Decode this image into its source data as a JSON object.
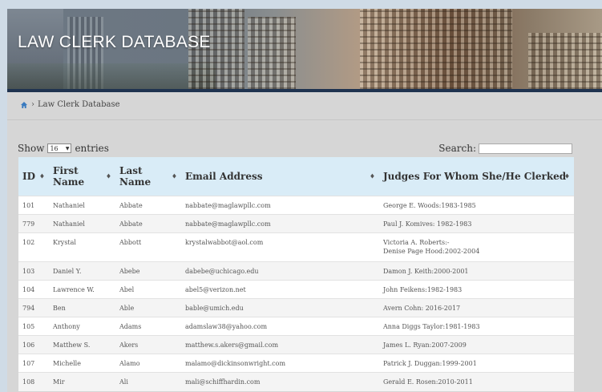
{
  "header": {
    "title": "LAW CLERK DATABASE"
  },
  "breadcrumb": {
    "icon": "home-icon",
    "separator": "›",
    "current": "Law Clerk Database"
  },
  "controls": {
    "show_label": "Show",
    "page_size": "16",
    "entries_label": "entries",
    "search_label": "Search:",
    "search_value": ""
  },
  "table": {
    "columns": [
      "ID",
      "First Name",
      "Last Name",
      "Email Address",
      "Judges For Whom She/He Clerked"
    ],
    "rows": [
      {
        "id": "101",
        "first": "Nathaniel",
        "last": "Abbate",
        "email": "nabbate@maglawpllc.com",
        "judges": "George E. Woods:1983-1985"
      },
      {
        "id": "779",
        "first": "Nathaniel",
        "last": "Abbate",
        "email": "nabbate@maglawpllc.com",
        "judges": "Paul J. Komives: 1982-1983"
      },
      {
        "id": "102",
        "first": "Krystal",
        "last": "Abbott",
        "email": "krystalwabbot@aol.com",
        "judges": "Victoria A. Roberts:-",
        "judges2": "Denise Page Hood:2002-2004"
      },
      {
        "id": "103",
        "first": "Daniel Y.",
        "last": "Abebe",
        "email": "dabebe@uchicago.edu",
        "judges": "Damon J. Keith:2000-2001"
      },
      {
        "id": "104",
        "first": "Lawrence W.",
        "last": "Abel",
        "email": "abel5@verizon.net",
        "judges": "John Feikens:1982-1983"
      },
      {
        "id": "794",
        "first": "Ben",
        "last": "Able",
        "email": "bable@umich.edu",
        "judges": "Avern Cohn: 2016-2017"
      },
      {
        "id": "105",
        "first": "Anthony",
        "last": "Adams",
        "email": "adamslaw38@yahoo.com",
        "judges": "Anna Diggs Taylor:1981-1983"
      },
      {
        "id": "106",
        "first": "Matthew S.",
        "last": "Akers",
        "email": "matthew.s.akers@gmail.com",
        "judges": "James L. Ryan:2007-2009"
      },
      {
        "id": "107",
        "first": "Michelle",
        "last": "Alamo",
        "email": "malamo@dickinsonwright.com",
        "judges": "Patrick J. Duggan:1999-2001"
      },
      {
        "id": "108",
        "first": "Mir",
        "last": "Ali",
        "email": "mali@schiffhardin.com",
        "judges": "Gerald E. Rosen:2010-2011"
      }
    ]
  },
  "colors": {
    "header_bg": "#d9ecf7",
    "banner_rule": "#1f3350",
    "link": "#2a6ebb"
  }
}
